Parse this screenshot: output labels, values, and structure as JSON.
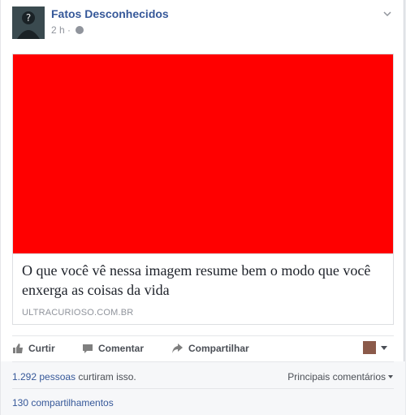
{
  "post": {
    "page_name": "Fatos Desconhecidos",
    "time": "2 h",
    "separator": "·",
    "privacy_icon": "globe-icon",
    "menu_icon": "chevron-down-icon"
  },
  "share": {
    "image_color": "#ff0000",
    "title": "O que você vê nessa imagem resume bem o modo que você enxerga as coisas da vida",
    "domain": "ULTRACURIOSO.COM.BR"
  },
  "actions": {
    "like_label": "Curtir",
    "comment_label": "Comentar",
    "share_label": "Compartilhar"
  },
  "stats": {
    "likes_count": "1.292 pessoas",
    "likes_suffix": " curtiram isso.",
    "top_comments": "Principais comentários",
    "shares": "130 compartilhamentos"
  },
  "colors": {
    "link": "#365899",
    "muted": "#90949c",
    "text": "#4b4f56"
  }
}
